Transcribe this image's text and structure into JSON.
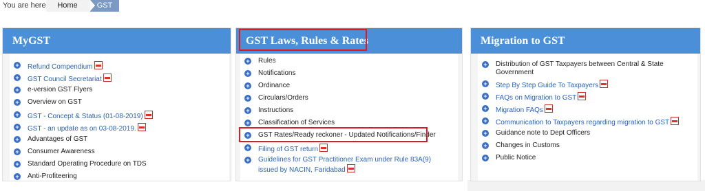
{
  "breadcrumb": {
    "prefix": "You are here::",
    "home": "Home",
    "current": "GST"
  },
  "panels": {
    "mygst": {
      "title": "MyGST",
      "items": [
        {
          "label": "Refund Compendium",
          "link": true,
          "pdf": true
        },
        {
          "label": "GST Council Secretariat",
          "link": true,
          "pdf": true
        },
        {
          "label": "e-version GST Flyers",
          "link": false,
          "pdf": false
        },
        {
          "label": "Overview on GST",
          "link": false,
          "pdf": false
        },
        {
          "label": "GST - Concept & Status (01-08-2019)",
          "link": true,
          "pdf": true
        },
        {
          "label": "GST - an update as on 03-08-2019.",
          "link": true,
          "pdf": true
        },
        {
          "label": "Advantages of GST",
          "link": false,
          "pdf": false
        },
        {
          "label": "Consumer Awareness",
          "link": false,
          "pdf": false
        },
        {
          "label": "Standard Operating Procedure on TDS",
          "link": false,
          "pdf": false
        },
        {
          "label": "Anti-Profiteering",
          "link": false,
          "pdf": false
        }
      ]
    },
    "laws": {
      "title": "GST Laws, Rules & Rates",
      "items": [
        {
          "label": "Rules",
          "link": false,
          "pdf": false
        },
        {
          "label": "Notifications",
          "link": false,
          "pdf": false
        },
        {
          "label": "Ordinance",
          "link": false,
          "pdf": false
        },
        {
          "label": "Circulars/Orders",
          "link": false,
          "pdf": false
        },
        {
          "label": "Instructions",
          "link": false,
          "pdf": false
        },
        {
          "label": "Classification of Services",
          "link": false,
          "pdf": false
        },
        {
          "label": "GST Rates/Ready reckoner - Updated Notifications/Finder",
          "link": false,
          "pdf": false
        },
        {
          "label": "Filing of GST return",
          "link": true,
          "pdf": true
        },
        {
          "label": "Guidelines for GST Practitioner Exam under Rule 83A(9) issued by NACIN, Faridabad",
          "link": true,
          "pdf": true
        }
      ]
    },
    "migration": {
      "title": "Migration to GST",
      "items": [
        {
          "label": "Distribution of GST Taxpayers between Central & State Government",
          "link": false,
          "pdf": false
        },
        {
          "label": "Step By Step Guide To Taxpayers",
          "link": true,
          "pdf": true
        },
        {
          "label": "FAQs on Migration to GST",
          "link": true,
          "pdf": true
        },
        {
          "label": "Migration FAQs",
          "link": true,
          "pdf": true
        },
        {
          "label": "Communication to Taxpayers regarding migration to GST",
          "link": true,
          "pdf": true
        },
        {
          "label": "Guidance note to Dept Officers",
          "link": false,
          "pdf": false
        },
        {
          "label": "Changes in Customs",
          "link": false,
          "pdf": false
        },
        {
          "label": "Public Notice",
          "link": false,
          "pdf": false
        }
      ]
    }
  },
  "colors": {
    "header": "#4a8fd8",
    "link": "#2a63b8",
    "bullet": "#3a6fc4",
    "highlight": "#e0191e"
  },
  "icons": {
    "bullet": "plus-circle-icon",
    "pdf": "pdf-icon"
  }
}
